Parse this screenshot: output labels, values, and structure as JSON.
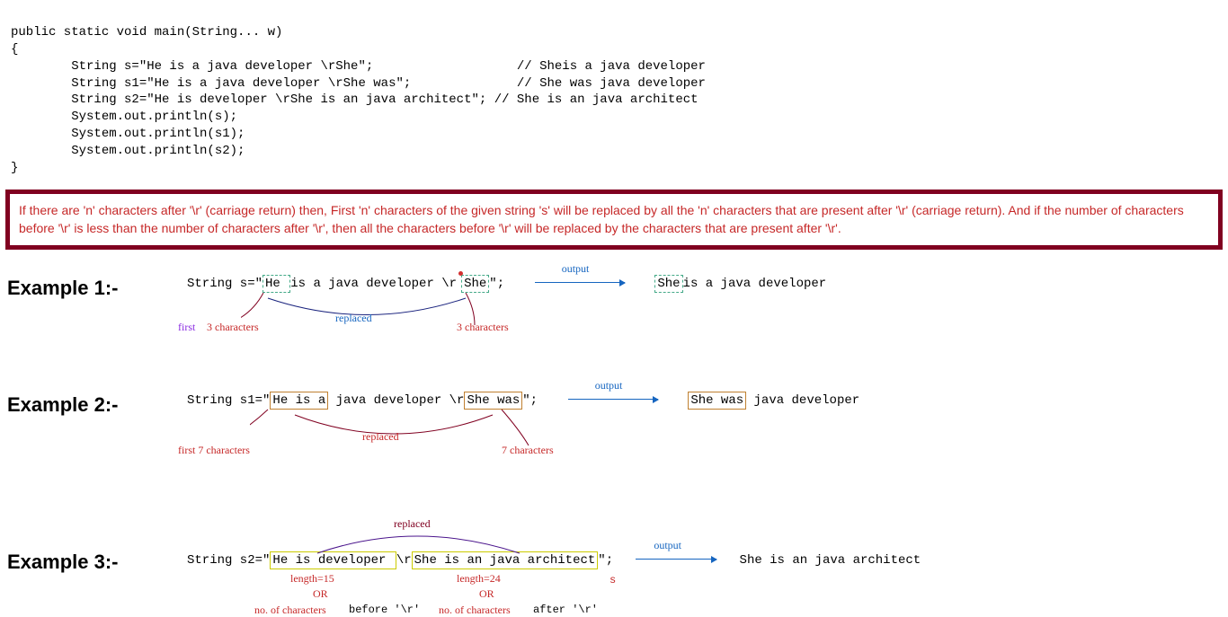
{
  "code": {
    "line1": "public static void main(String... w)",
    "line2": "{",
    "line3": "        String s=\"He is a java developer \\rShe\";                   // Sheis a java developer",
    "line4": "        String s1=\"He is a java developer \\rShe was\";              // She was java developer",
    "line5": "        String s2=\"He is developer \\rShe is an java architect\"; // She is an java architect",
    "line6": "        System.out.println(s);",
    "line7": "        System.out.println(s1);",
    "line8": "        System.out.println(s2);",
    "line9": "}"
  },
  "info_text": "If there are 'n' characters after '\\r' (carriage return) then, First 'n' characters of the given string 's' will be replaced by all the 'n' characters that are present after '\\r' (carriage return). And if the number of characters before '\\r' is less than the number of characters after '\\r', then all the characters before '\\r' will be replaced by the characters that are present after '\\r'.",
  "ex1": {
    "label": "Example 1:-",
    "prefix": "String s=\"",
    "part1": "He ",
    "mid": "is a java developer \\r",
    "part2": "She",
    "suffix": "\";",
    "output_label": "output",
    "output": "is a java developer",
    "ann_first": "first",
    "ann_3a": "3 characters",
    "ann_replaced": "replaced",
    "ann_3b": "3 characters",
    "out_pre": "She"
  },
  "ex2": {
    "label": "Example 2:-",
    "prefix": "String s1=\"",
    "part1": "He is a",
    "mid": " java developer \\r",
    "part2": "She was",
    "suffix": "\";",
    "output_label": "output",
    "output_pre": "She was",
    "output_rest": " java developer",
    "ann_first": "first 7 characters",
    "ann_replaced": "replaced",
    "ann_7": "7 characters"
  },
  "ex3": {
    "label": "Example 3:-",
    "prefix": "String s2=\"",
    "part1": "He is developer ",
    "mid": "\\r",
    "part2": "She is an java architect",
    "suffix": "\";",
    "output_label": "output",
    "output": "She is an java architect",
    "ann_replaced": "replaced",
    "len1": "length=15",
    "len2": "length=24",
    "or1": "OR",
    "or2": "OR",
    "nchar1": "no. of characters",
    "before": "before '\\r'",
    "nchar2": "no. of characters",
    "after": "after '\\r'",
    "stray": "s"
  }
}
